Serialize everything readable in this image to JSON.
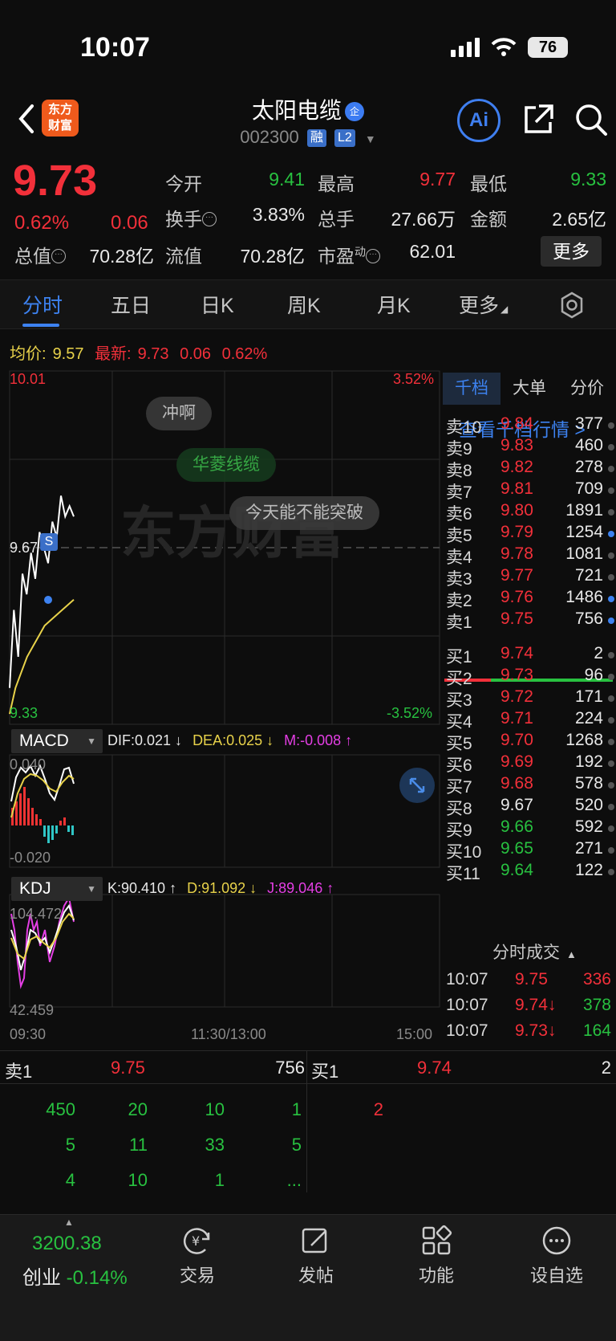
{
  "status": {
    "time": "10:07",
    "battery": "76"
  },
  "nav": {
    "logo_line1": "东方",
    "logo_line2": "财富",
    "title": "太阳电缆",
    "title_badge": "企",
    "code": "002300",
    "tag_margin": "融",
    "tag_level": "L2",
    "ai_label": "Ai"
  },
  "quote": {
    "price": "9.73",
    "pct": "0.62%",
    "change": "0.06",
    "fields": {
      "open_label": "今开",
      "open": "9.41",
      "high_label": "最高",
      "high": "9.77",
      "low_label": "最低",
      "low": "9.33",
      "turnover_label": "换手",
      "turnover": "3.83%",
      "volume_label": "总手",
      "volume": "27.66万",
      "amount_label": "金额",
      "amount": "2.65亿",
      "mktcap_label": "总值",
      "mktcap": "70.28亿",
      "float_label": "流值",
      "float": "70.28亿",
      "pe_label": "市盈",
      "pe_sup": "动",
      "pe": "62.01"
    },
    "more": "更多"
  },
  "tabs": [
    "分时",
    "五日",
    "日K",
    "周K",
    "月K",
    "更多"
  ],
  "avg": {
    "avg_label": "均价:",
    "avg_value": "9.57",
    "last_label": "最新:",
    "last_value": "9.73",
    "last_change": "0.06",
    "last_pct": "0.62%"
  },
  "chart": {
    "y_top": "10.01",
    "y_mid": "9.67",
    "y_bottom": "9.33",
    "pct_top": "3.52%",
    "pct_bottom": "-3.52%",
    "x_start": "09:30",
    "x_mid": "11:30/13:00",
    "x_end": "15:00",
    "watermark": "东方财富",
    "marker": "S",
    "bubbles": [
      "冲啊",
      "华菱线缆",
      "今天能不能突破"
    ],
    "macd": {
      "name": "MACD",
      "dif": "DIF:0.021 ↓",
      "dea": "DEA:0.025 ↓",
      "m": "M:-0.008 ↑",
      "top": "0.040",
      "bottom": "-0.020"
    },
    "kdj": {
      "name": "KDJ",
      "k": "K:90.410 ↑",
      "d": "D:91.092 ↓",
      "j": "J:89.046 ↑",
      "top": "104.472",
      "bottom": "42.459"
    }
  },
  "chart_data": {
    "type": "line",
    "x_range": [
      "09:30",
      "15:00"
    ],
    "ylim": [
      9.33,
      10.01
    ],
    "series": [
      {
        "values": [
          9.4,
          9.55,
          9.46,
          9.62,
          9.58,
          9.66,
          9.61,
          9.7,
          9.67,
          9.64,
          9.72,
          9.69,
          9.77,
          9.73,
          9.75,
          9.73
        ]
      },
      {
        "values": [
          9.35,
          9.4,
          9.43,
          9.46,
          9.48,
          9.5,
          9.52,
          9.53,
          9.54,
          9.55,
          9.56,
          9.57
        ]
      }
    ]
  },
  "book": {
    "tabs": [
      "千档",
      "大单",
      "分价"
    ],
    "link": "查看千档行情 >",
    "asks": [
      {
        "label": "卖10",
        "price": "9.84",
        "vol": "377",
        "dot": false
      },
      {
        "label": "卖9",
        "price": "9.83",
        "vol": "460",
        "dot": false
      },
      {
        "label": "卖8",
        "price": "9.82",
        "vol": "278",
        "dot": false
      },
      {
        "label": "卖7",
        "price": "9.81",
        "vol": "709",
        "dot": false
      },
      {
        "label": "卖6",
        "price": "9.80",
        "vol": "1891",
        "dot": false
      },
      {
        "label": "卖5",
        "price": "9.79",
        "vol": "1254",
        "dot": true
      },
      {
        "label": "卖4",
        "price": "9.78",
        "vol": "1081",
        "dot": false
      },
      {
        "label": "卖3",
        "price": "9.77",
        "vol": "721",
        "dot": false
      },
      {
        "label": "卖2",
        "price": "9.76",
        "vol": "1486",
        "dot": true
      },
      {
        "label": "卖1",
        "price": "9.75",
        "vol": "756",
        "dot": true
      }
    ],
    "bids": [
      {
        "label": "买1",
        "price": "9.74",
        "vol": "2",
        "color": "red"
      },
      {
        "label": "买2",
        "price": "9.73",
        "vol": "96",
        "color": "red"
      },
      {
        "label": "买3",
        "price": "9.72",
        "vol": "171",
        "color": "red"
      },
      {
        "label": "买4",
        "price": "9.71",
        "vol": "224",
        "color": "red"
      },
      {
        "label": "买5",
        "price": "9.70",
        "vol": "1268",
        "color": "red"
      },
      {
        "label": "买6",
        "price": "9.69",
        "vol": "192",
        "color": "red"
      },
      {
        "label": "买7",
        "price": "9.68",
        "vol": "578",
        "color": "red"
      },
      {
        "label": "买8",
        "price": "9.67",
        "vol": "520",
        "color": "white"
      },
      {
        "label": "买9",
        "price": "9.66",
        "vol": "592",
        "color": "green"
      },
      {
        "label": "买10",
        "price": "9.65",
        "vol": "271",
        "color": "green"
      },
      {
        "label": "买11",
        "price": "9.64",
        "vol": "122",
        "color": "green"
      }
    ],
    "ticks_title": "分时成交",
    "ticks": [
      {
        "time": "10:07",
        "price": "9.75",
        "vol": "336",
        "dir": "",
        "vcolor": "red"
      },
      {
        "time": "10:07",
        "price": "9.74↓",
        "vol": "378",
        "dir": "",
        "vcolor": "green"
      },
      {
        "time": "10:07",
        "price": "9.73↓",
        "vol": "164",
        "dir": "",
        "vcolor": "green"
      }
    ]
  },
  "queue": {
    "sell_label": "卖1",
    "sell_price": "9.75",
    "sell_vol": "756",
    "buy_label": "买1",
    "buy_price": "9.74",
    "buy_vol": "2",
    "sell_rows": [
      [
        "450",
        "20",
        "10",
        "1"
      ],
      [
        "5",
        "11",
        "33",
        "5"
      ],
      [
        "4",
        "10",
        "1",
        "..."
      ]
    ],
    "buy_rows": [
      [
        "2"
      ]
    ]
  },
  "bottom": {
    "index_value": "3200.38",
    "index_name": "创业",
    "index_pct": "-0.14%",
    "items": [
      "交易",
      "发帖",
      "功能",
      "设自选"
    ]
  }
}
